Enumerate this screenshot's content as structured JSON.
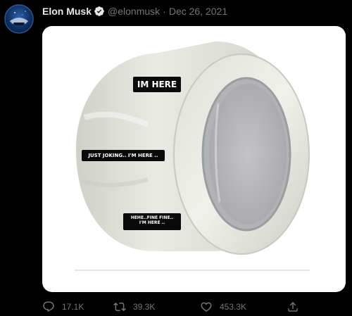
{
  "tweet": {
    "author_name": "Elon Musk",
    "handle": "@elonmusk",
    "separator": "·",
    "date": "Dec 26, 2021",
    "verified_icon": "verified-badge-icon",
    "avatar_icon": "avatar-image"
  },
  "media": {
    "labels": {
      "label_1": "IM HERE",
      "label_2": "JUST JOKING.. I'M HERE ..",
      "label_3_line_1": "HEHE..FINE FINE..",
      "label_3_line_2": "I'M HERE .."
    }
  },
  "actions": {
    "reply_count": "17.1K",
    "retweet_count": "39.3K",
    "like_count": "453.3K",
    "reply_icon": "reply-icon",
    "retweet_icon": "retweet-icon",
    "like_icon": "like-icon",
    "share_icon": "share-icon"
  },
  "colors": {
    "background": "#000000",
    "primary_text": "#e7e9ea",
    "secondary_text": "#71767b",
    "verified_blue": "#1d9bf0"
  }
}
